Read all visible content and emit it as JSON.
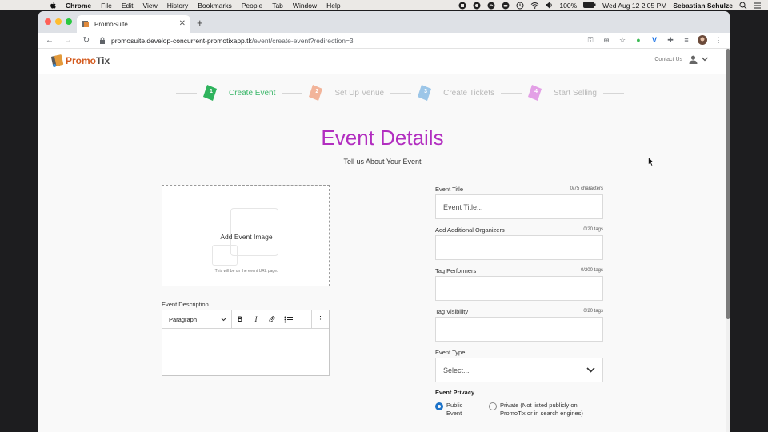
{
  "menubar": {
    "app": "Chrome",
    "items": [
      "File",
      "Edit",
      "View",
      "History",
      "Bookmarks",
      "People",
      "Tab",
      "Window",
      "Help"
    ],
    "battery": "100%",
    "datetime": "Wed Aug 12  2:05 PM",
    "user": "Sebastian Schulze"
  },
  "browser": {
    "tab_title": "PromoSuite",
    "url_host": "promosuite.develop-concurrent-promotixapp.tk",
    "url_path": "/event/create-event?redirection=3"
  },
  "site": {
    "logo_promo": "Promo",
    "logo_tix": "Tix",
    "contact": "Contact Us"
  },
  "steps": [
    {
      "num": "1",
      "label": "Create Event",
      "color": "#3cb76a"
    },
    {
      "num": "2",
      "label": "Set Up Venue",
      "color": "#f2b49a"
    },
    {
      "num": "3",
      "label": "Create Tickets",
      "color": "#9cc6e8"
    },
    {
      "num": "4",
      "label": "Start Selling",
      "color": "#e3a0e6"
    }
  ],
  "page": {
    "title": "Event Details",
    "subtitle": "Tell us About Your Event"
  },
  "image_upload": {
    "label": "Add Event Image",
    "note": "This will be on the event URL page."
  },
  "description": {
    "label": "Event Description",
    "paragraph_select": "Paragraph"
  },
  "form": {
    "event_title": {
      "label": "Event Title",
      "count": "0/75 characters",
      "placeholder": "Event Title..."
    },
    "organizers": {
      "label": "Add Additional Organizers",
      "count": "0/20 tags"
    },
    "performers": {
      "label": "Tag Performers",
      "count": "0/200 tags"
    },
    "visibility": {
      "label": "Tag Visibility",
      "count": "0/20 tags"
    },
    "event_type": {
      "label": "Event Type",
      "value": "Select..."
    },
    "privacy": {
      "label": "Event Privacy",
      "public": "Public Event",
      "public_l1": "Public",
      "public_l2": "Event",
      "private_l1": "Private (Not listed publicly on",
      "private_l2": "PromoTix or in search engines)"
    }
  }
}
